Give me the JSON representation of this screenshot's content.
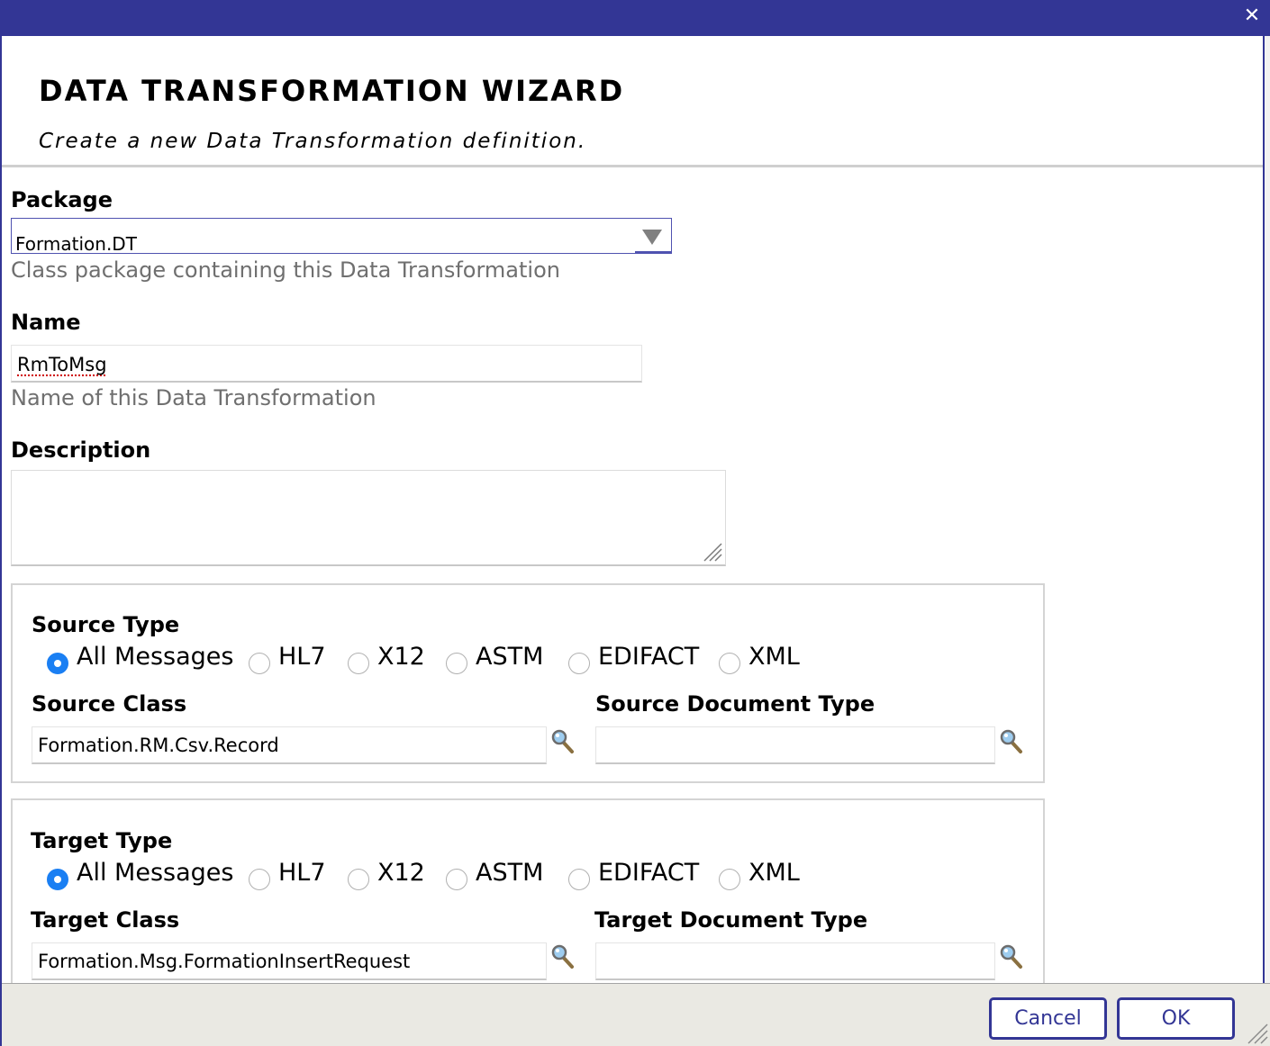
{
  "dialog": {
    "title": "DATA TRANSFORMATION WIZARD",
    "subtitle": "Create a new Data Transformation definition.",
    "close_icon": "close-icon"
  },
  "package": {
    "label": "Package",
    "value": "Formation.DT",
    "hint": "Class package containing this Data Transformation"
  },
  "name": {
    "label": "Name",
    "value": "RmToMsg",
    "hint": "Name of this Data Transformation"
  },
  "description": {
    "label": "Description",
    "value": ""
  },
  "source": {
    "type_label": "Source Type",
    "types": [
      "All Messages",
      "HL7",
      "X12",
      "ASTM",
      "EDIFACT",
      "XML"
    ],
    "selected_type": "All Messages",
    "class_label": "Source Class",
    "class_value": "Formation.RM.Csv.Record",
    "doc_type_label": "Source Document Type",
    "doc_type_value": ""
  },
  "target": {
    "type_label": "Target Type",
    "types": [
      "All Messages",
      "HL7",
      "X12",
      "ASTM",
      "EDIFACT",
      "XML"
    ],
    "selected_type": "All Messages",
    "class_label": "Target Class",
    "class_value": "Formation.Msg.FormationInsertRequest",
    "doc_type_label": "Target Document Type",
    "doc_type_value": ""
  },
  "buttons": {
    "cancel": "Cancel",
    "ok": "OK"
  },
  "colors": {
    "titlebar": "#333695",
    "hint_text": "#6f6f6f",
    "radio_checked": "#1a7ff3",
    "footer_bg": "#eae9e3"
  }
}
